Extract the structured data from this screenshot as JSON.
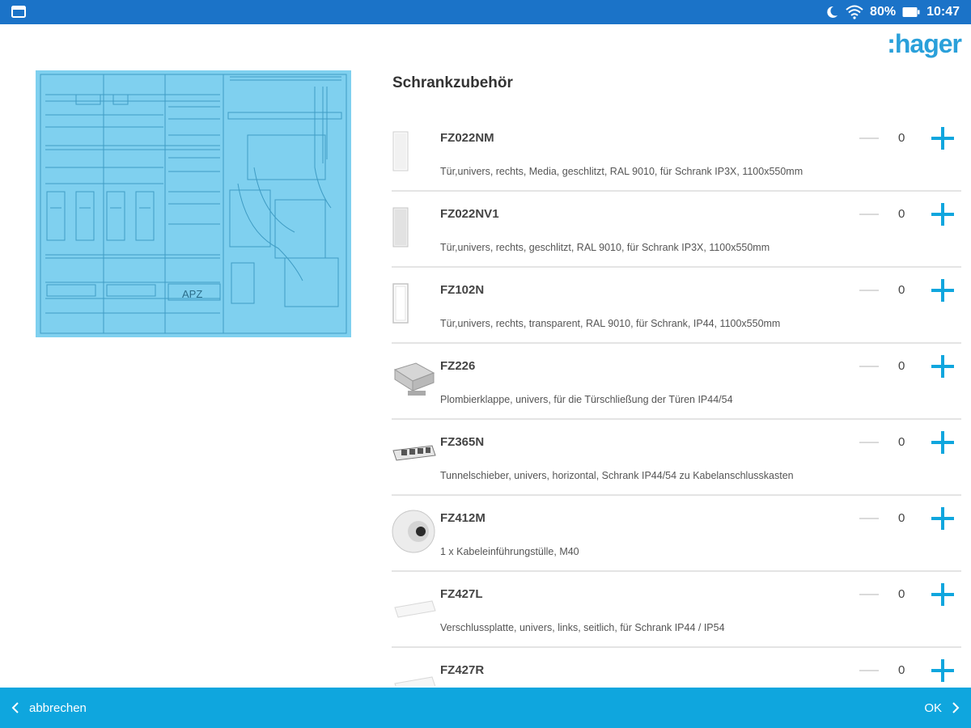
{
  "statusbar": {
    "battery": "80%",
    "time": "10:47"
  },
  "brand": {
    "logo": ":hager",
    "color": "#2aa0da"
  },
  "preview": {
    "apz_label": "APZ"
  },
  "section": {
    "title": "Schrankzubehör"
  },
  "items": [
    {
      "code": "FZ022NM",
      "desc": "Tür,univers, rechts, Media, geschlitzt, RAL 9010, für Schrank IP3X, 1100x550mm",
      "qty": "0",
      "thumb": "door-icon"
    },
    {
      "code": "FZ022NV1",
      "desc": "Tür,univers, rechts, geschlitzt, RAL 9010, für Schrank IP3X, 1100x550mm",
      "qty": "0",
      "thumb": "door-icon"
    },
    {
      "code": "FZ102N",
      "desc": "Tür,univers, rechts, transparent, RAL 9010, für Schrank, IP44, 1100x550mm",
      "qty": "0",
      "thumb": "frame-icon"
    },
    {
      "code": "FZ226",
      "desc": "Plombierklappe, univers, für die Türschließung der Türen IP44/54",
      "qty": "0",
      "thumb": "flap-icon"
    },
    {
      "code": "FZ365N",
      "desc": "Tunnelschieber, univers, horizontal, Schrank IP44/54 zu Kabelanschlusskasten",
      "qty": "0",
      "thumb": "slider-icon"
    },
    {
      "code": "FZ412M",
      "desc": "1 x Kabeleinführungstülle, M40",
      "qty": "0",
      "thumb": "grommet-icon"
    },
    {
      "code": "FZ427L",
      "desc": "Verschlussplatte, univers, links, seitlich, für Schrank IP44 / IP54",
      "qty": "0",
      "thumb": "plate-icon"
    },
    {
      "code": "FZ427R",
      "desc": "",
      "qty": "0",
      "thumb": "plate-icon"
    }
  ],
  "footer": {
    "cancel_label": "abbrechen",
    "ok_label": "OK"
  },
  "colors": {
    "statusbar": "#1b73c8",
    "footer": "#0fa6de",
    "accent": "#0fa6de",
    "preview": "#7fd0ef"
  }
}
